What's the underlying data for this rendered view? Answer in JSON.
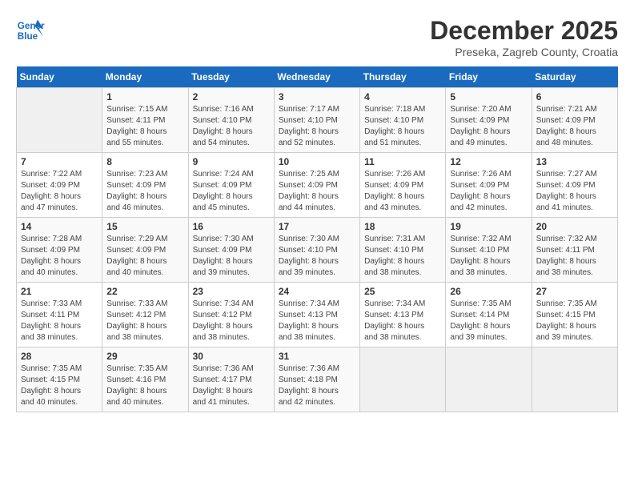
{
  "logo": {
    "line1": "General",
    "line2": "Blue"
  },
  "title": "December 2025",
  "subtitle": "Preseka, Zagreb County, Croatia",
  "weekdays": [
    "Sunday",
    "Monday",
    "Tuesday",
    "Wednesday",
    "Thursday",
    "Friday",
    "Saturday"
  ],
  "weeks": [
    [
      {
        "day": "",
        "info": ""
      },
      {
        "day": "1",
        "info": "Sunrise: 7:15 AM\nSunset: 4:11 PM\nDaylight: 8 hours\nand 55 minutes."
      },
      {
        "day": "2",
        "info": "Sunrise: 7:16 AM\nSunset: 4:10 PM\nDaylight: 8 hours\nand 54 minutes."
      },
      {
        "day": "3",
        "info": "Sunrise: 7:17 AM\nSunset: 4:10 PM\nDaylight: 8 hours\nand 52 minutes."
      },
      {
        "day": "4",
        "info": "Sunrise: 7:18 AM\nSunset: 4:10 PM\nDaylight: 8 hours\nand 51 minutes."
      },
      {
        "day": "5",
        "info": "Sunrise: 7:20 AM\nSunset: 4:09 PM\nDaylight: 8 hours\nand 49 minutes."
      },
      {
        "day": "6",
        "info": "Sunrise: 7:21 AM\nSunset: 4:09 PM\nDaylight: 8 hours\nand 48 minutes."
      }
    ],
    [
      {
        "day": "7",
        "info": "Sunrise: 7:22 AM\nSunset: 4:09 PM\nDaylight: 8 hours\nand 47 minutes."
      },
      {
        "day": "8",
        "info": "Sunrise: 7:23 AM\nSunset: 4:09 PM\nDaylight: 8 hours\nand 46 minutes."
      },
      {
        "day": "9",
        "info": "Sunrise: 7:24 AM\nSunset: 4:09 PM\nDaylight: 8 hours\nand 45 minutes."
      },
      {
        "day": "10",
        "info": "Sunrise: 7:25 AM\nSunset: 4:09 PM\nDaylight: 8 hours\nand 44 minutes."
      },
      {
        "day": "11",
        "info": "Sunrise: 7:26 AM\nSunset: 4:09 PM\nDaylight: 8 hours\nand 43 minutes."
      },
      {
        "day": "12",
        "info": "Sunrise: 7:26 AM\nSunset: 4:09 PM\nDaylight: 8 hours\nand 42 minutes."
      },
      {
        "day": "13",
        "info": "Sunrise: 7:27 AM\nSunset: 4:09 PM\nDaylight: 8 hours\nand 41 minutes."
      }
    ],
    [
      {
        "day": "14",
        "info": "Sunrise: 7:28 AM\nSunset: 4:09 PM\nDaylight: 8 hours\nand 40 minutes."
      },
      {
        "day": "15",
        "info": "Sunrise: 7:29 AM\nSunset: 4:09 PM\nDaylight: 8 hours\nand 40 minutes."
      },
      {
        "day": "16",
        "info": "Sunrise: 7:30 AM\nSunset: 4:09 PM\nDaylight: 8 hours\nand 39 minutes."
      },
      {
        "day": "17",
        "info": "Sunrise: 7:30 AM\nSunset: 4:10 PM\nDaylight: 8 hours\nand 39 minutes."
      },
      {
        "day": "18",
        "info": "Sunrise: 7:31 AM\nSunset: 4:10 PM\nDaylight: 8 hours\nand 38 minutes."
      },
      {
        "day": "19",
        "info": "Sunrise: 7:32 AM\nSunset: 4:10 PM\nDaylight: 8 hours\nand 38 minutes."
      },
      {
        "day": "20",
        "info": "Sunrise: 7:32 AM\nSunset: 4:11 PM\nDaylight: 8 hours\nand 38 minutes."
      }
    ],
    [
      {
        "day": "21",
        "info": "Sunrise: 7:33 AM\nSunset: 4:11 PM\nDaylight: 8 hours\nand 38 minutes."
      },
      {
        "day": "22",
        "info": "Sunrise: 7:33 AM\nSunset: 4:12 PM\nDaylight: 8 hours\nand 38 minutes."
      },
      {
        "day": "23",
        "info": "Sunrise: 7:34 AM\nSunset: 4:12 PM\nDaylight: 8 hours\nand 38 minutes."
      },
      {
        "day": "24",
        "info": "Sunrise: 7:34 AM\nSunset: 4:13 PM\nDaylight: 8 hours\nand 38 minutes."
      },
      {
        "day": "25",
        "info": "Sunrise: 7:34 AM\nSunset: 4:13 PM\nDaylight: 8 hours\nand 38 minutes."
      },
      {
        "day": "26",
        "info": "Sunrise: 7:35 AM\nSunset: 4:14 PM\nDaylight: 8 hours\nand 39 minutes."
      },
      {
        "day": "27",
        "info": "Sunrise: 7:35 AM\nSunset: 4:15 PM\nDaylight: 8 hours\nand 39 minutes."
      }
    ],
    [
      {
        "day": "28",
        "info": "Sunrise: 7:35 AM\nSunset: 4:15 PM\nDaylight: 8 hours\nand 40 minutes."
      },
      {
        "day": "29",
        "info": "Sunrise: 7:35 AM\nSunset: 4:16 PM\nDaylight: 8 hours\nand 40 minutes."
      },
      {
        "day": "30",
        "info": "Sunrise: 7:36 AM\nSunset: 4:17 PM\nDaylight: 8 hours\nand 41 minutes."
      },
      {
        "day": "31",
        "info": "Sunrise: 7:36 AM\nSunset: 4:18 PM\nDaylight: 8 hours\nand 42 minutes."
      },
      {
        "day": "",
        "info": ""
      },
      {
        "day": "",
        "info": ""
      },
      {
        "day": "",
        "info": ""
      }
    ]
  ]
}
